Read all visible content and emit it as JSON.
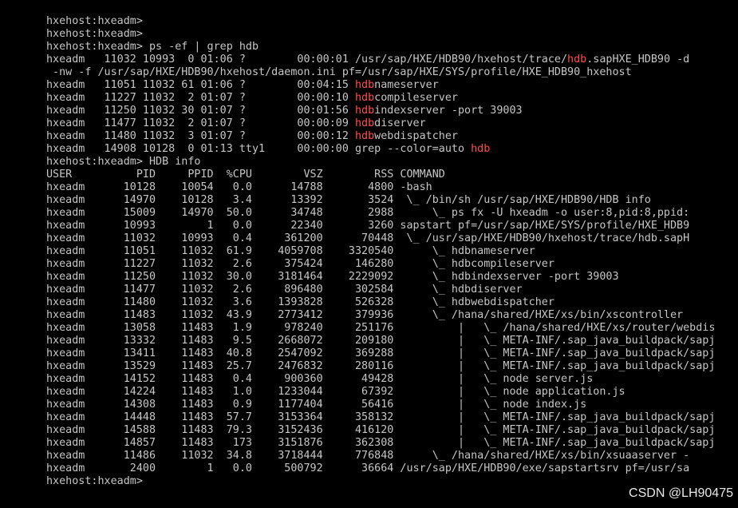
{
  "terminal": {
    "colors": {
      "background": "#000000",
      "text": "#c6c6c6",
      "highlight": "#ff4d4d"
    },
    "lines": [
      [
        {
          "t": "hxehost:hxeadm>"
        }
      ],
      [
        {
          "t": "hxehost:hxeadm>"
        }
      ],
      [
        {
          "t": "hxehost:hxeadm> ps -ef | grep hdb"
        }
      ],
      [
        {
          "t": "hxeadm   11032 10993  0 01:06 ?        00:00:01 /usr/sap/HXE/HDB90/hxehost/trace/"
        },
        {
          "t": "hdb",
          "hl": true
        },
        {
          "t": ".sapHXE_HDB90 -d"
        }
      ],
      [
        {
          "t": " -nw -f /usr/sap/HXE/HDB90/hxehost/daemon.ini pf=/usr/sap/HXE/SYS/profile/HXE_HDB90_hxehost"
        }
      ],
      [
        {
          "t": "hxeadm   11051 11032 61 01:06 ?        00:04:15 "
        },
        {
          "t": "hdb",
          "hl": true
        },
        {
          "t": "nameserver"
        }
      ],
      [
        {
          "t": "hxeadm   11227 11032  2 01:07 ?        00:00:10 "
        },
        {
          "t": "hdb",
          "hl": true
        },
        {
          "t": "compileserver"
        }
      ],
      [
        {
          "t": "hxeadm   11250 11032 30 01:07 ?        00:01:56 "
        },
        {
          "t": "hdb",
          "hl": true
        },
        {
          "t": "indexserver -port 39003"
        }
      ],
      [
        {
          "t": "hxeadm   11477 11032  2 01:07 ?        00:00:09 "
        },
        {
          "t": "hdb",
          "hl": true
        },
        {
          "t": "diserver"
        }
      ],
      [
        {
          "t": "hxeadm   11480 11032  3 01:07 ?        00:00:12 "
        },
        {
          "t": "hdb",
          "hl": true
        },
        {
          "t": "webdispatcher"
        }
      ],
      [
        {
          "t": "hxeadm   14908 10128  0 01:13 tty1     00:00:00 grep --color=auto "
        },
        {
          "t": "hdb",
          "hl": true
        }
      ],
      [
        {
          "t": "hxehost:hxeadm> HDB info"
        }
      ],
      [
        {
          "t": "USER          PID     PPID  %CPU        VSZ        RSS COMMAND"
        }
      ],
      [
        {
          "t": "hxeadm      10128    10054   0.0      14788       4800 -bash"
        }
      ],
      [
        {
          "t": "hxeadm      14970    10128   3.4      13392       3524  \\_ /bin/sh /usr/sap/HXE/HDB90/HDB info"
        }
      ],
      [
        {
          "t": "hxeadm      15009    14970  50.0      34748       2988      \\_ ps fx -U hxeadm -o user:8,pid:8,ppid:"
        }
      ],
      [
        {
          "t": "hxeadm      10993        1   0.0      22340       3260 sapstart pf=/usr/sap/HXE/SYS/profile/HXE_HDB9"
        }
      ],
      [
        {
          "t": "hxeadm      11032    10993   0.4     361200      70448  \\_ /usr/sap/HXE/HDB90/hxehost/trace/hdb.sapH"
        }
      ],
      [
        {
          "t": "hxeadm      11051    11032  61.9    4059708    3320540      \\_ hdbnameserver"
        }
      ],
      [
        {
          "t": "hxeadm      11227    11032   2.6     375424     146280      \\_ hdbcompileserver"
        }
      ],
      [
        {
          "t": "hxeadm      11250    11032  30.0    3181464    2229092      \\_ hdbindexserver -port 39003"
        }
      ],
      [
        {
          "t": "hxeadm      11477    11032   2.6     896480     302584      \\_ hdbdiserver"
        }
      ],
      [
        {
          "t": "hxeadm      11480    11032   3.6    1393828     526328      \\_ hdbwebdispatcher"
        }
      ],
      [
        {
          "t": "hxeadm      11483    11032  43.9    2773412     379936      \\_ /hana/shared/HXE/xs/bin/xscontroller"
        }
      ],
      [
        {
          "t": "hxeadm      13058    11483   1.9     978240     251176          |   \\_ /hana/shared/HXE/xs/router/webdis"
        }
      ],
      [
        {
          "t": "hxeadm      13332    11483   9.5    2668072     209180          |   \\_ META-INF/.sap_java_buildpack/sapj"
        }
      ],
      [
        {
          "t": "hxeadm      13411    11483  40.8    2547092     369288          |   \\_ META-INF/.sap_java_buildpack/sapj"
        }
      ],
      [
        {
          "t": "hxeadm      13529    11483  25.7    2476832     280116          |   \\_ META-INF/.sap_java_buildpack/sapj"
        }
      ],
      [
        {
          "t": "hxeadm      14152    11483   0.4     900360      49428          |   \\_ node server.js"
        }
      ],
      [
        {
          "t": "hxeadm      14224    11483   1.0    1233044      67392          |   \\_ node application.js"
        }
      ],
      [
        {
          "t": "hxeadm      14308    11483   0.9    1177404      56416          |   \\_ node index.js"
        }
      ],
      [
        {
          "t": "hxeadm      14448    11483  57.7    3153364     358132          |   \\_ META-INF/.sap_java_buildpack/sapj"
        }
      ],
      [
        {
          "t": "hxeadm      14588    11483  79.3    3152436     416120          |   \\_ META-INF/.sap_java_buildpack/sapj"
        }
      ],
      [
        {
          "t": "hxeadm      14857    11483   173    3151876     362308          |   \\_ META-INF/.sap_java_buildpack/sapj"
        }
      ],
      [
        {
          "t": "hxeadm      11486    11032  34.8    3718444     776848      \\_ /hana/shared/HXE/xs/bin/xsuaaserver -"
        }
      ],
      [
        {
          "t": "hxeadm       2400        1   0.0     500792      36664 /usr/sap/HXE/HDB90/exe/sapstartsrv pf=/usr/sa"
        }
      ],
      [
        {
          "t": "hxehost:hxeadm>"
        }
      ]
    ]
  },
  "watermark": {
    "text": "CSDN @LH90475"
  }
}
